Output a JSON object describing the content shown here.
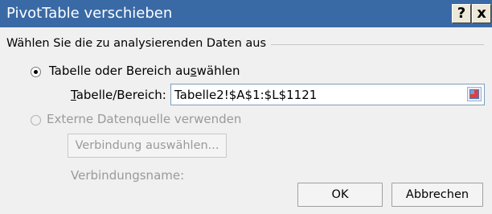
{
  "window": {
    "title": "PivotTable verschieben",
    "help_label": "?",
    "close_label": "x"
  },
  "group": {
    "label": "Wählen Sie die zu analysierenden Daten aus"
  },
  "option_range": {
    "label_pre": "Tabelle oder Bereich au",
    "label_u": "s",
    "label_post": "wählen",
    "checked": true
  },
  "range_field": {
    "label_u": "T",
    "label_post": "abelle/Bereich:",
    "value": "Tabelle2!$A$1:$L$1121"
  },
  "option_external": {
    "label": "Externe Datenquelle verwenden",
    "checked": false,
    "enabled": false
  },
  "choose_connection_button": "Verbindung auswählen...",
  "connection_name_label": "Verbindungsname:",
  "ok_button": "OK",
  "cancel_button": "Abbrechen",
  "colors": {
    "titlebar": "#3a6aa6",
    "dialog_bg": "#f0f0f0",
    "disabled_text": "#9a9a9a"
  },
  "icons": {
    "collapse_dialog": "range-select-icon"
  }
}
